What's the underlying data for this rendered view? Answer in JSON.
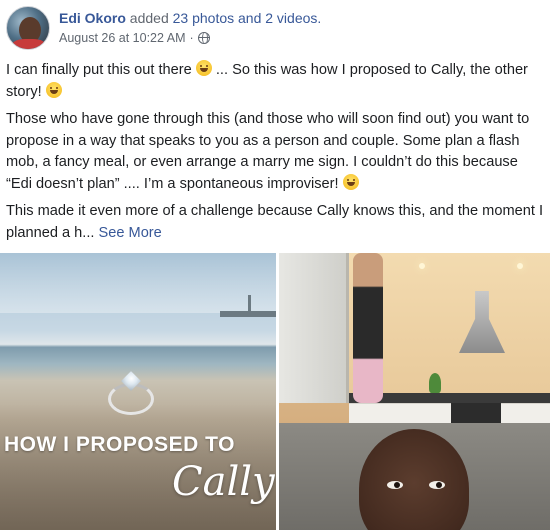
{
  "post": {
    "author": "Edi Okoro",
    "action": "added",
    "media_count": "23 photos and 2 videos.",
    "date": "August 26 at 10:22 AM",
    "meta_separator": "·",
    "privacy_icon": "globe-icon"
  },
  "body": {
    "p1_a": "I can finally put this out there ",
    "p1_b": " ... So this was how I proposed to Cally, the other story! ",
    "p2_a": "Those who have gone through this (and those who will soon find out) you want to propose in a way that speaks to you as a person and couple. Some plan a flash mob, a fancy meal, or even arrange a marry me sign. I couldn’t do this because “Edi doesn’t plan” .... I’m a spontaneous improviser! ",
    "p3_a": "This made it even more of a challenge because Cally knows this, and the moment I planned a h... ",
    "see_more": "See More"
  },
  "media": {
    "photo1_caption_line1": "HOW I PROPOSED TO",
    "photo1_caption_line2": "Cally"
  },
  "colors": {
    "link": "#385898",
    "meta": "#606770",
    "text": "#1c1e21"
  }
}
